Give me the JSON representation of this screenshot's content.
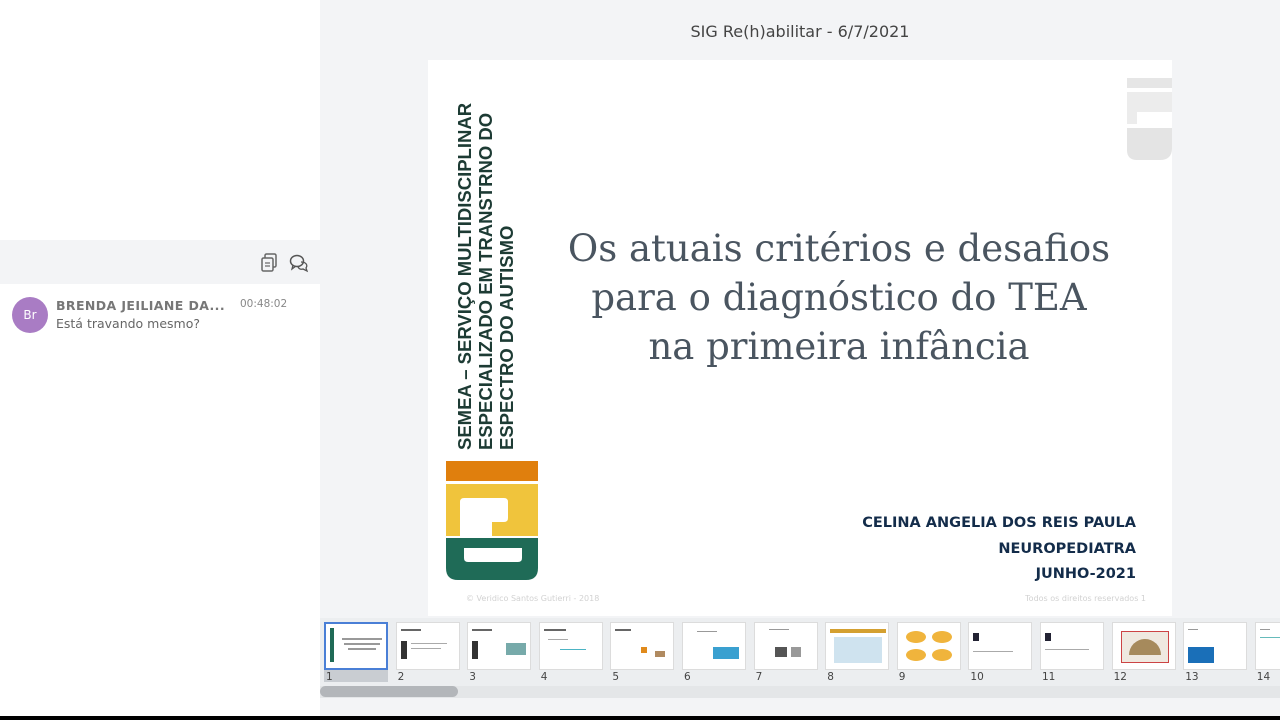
{
  "presentation": {
    "title": "SIG Re(h)abilitar - 6/7/2021"
  },
  "chat": {
    "messages": [
      {
        "avatar_initials": "Br",
        "author": "BRENDA JEILIANE DA...",
        "time": "00:48:02",
        "text": "Está travando mesmo?"
      }
    ],
    "toolbar_icons": [
      "copy-icon",
      "chat-bubbles-icon"
    ]
  },
  "slide": {
    "vertical_lines": [
      "SEMEA – SERVIÇO MULTIDISCIPLINAR",
      "ESPECIALIZADO EM TRANSTRNO DO",
      "ESPECTRO DO AUTISMO"
    ],
    "title_lines": [
      "Os atuais critérios e desafios",
      "para o diagnóstico do TEA",
      "na primeira infância"
    ],
    "author_lines": [
      "CELINA ANGELIA DOS REIS PAULA",
      "NEUROPEDIATRA",
      "JUNHO-2021"
    ],
    "footer_left": "© Veridico Santos Gutierri - 2018",
    "footer_right": "Todos os direitos reservados     1",
    "colors": {
      "orange": "#e07f0d",
      "yellow": "#f0c43c",
      "green": "#1f6b57"
    }
  },
  "thumbnails": [
    {
      "num": "1",
      "selected": true
    },
    {
      "num": "2"
    },
    {
      "num": "3"
    },
    {
      "num": "4"
    },
    {
      "num": "5"
    },
    {
      "num": "6"
    },
    {
      "num": "7"
    },
    {
      "num": "8"
    },
    {
      "num": "9"
    },
    {
      "num": "10"
    },
    {
      "num": "11"
    },
    {
      "num": "12"
    },
    {
      "num": "13"
    },
    {
      "num": "14"
    }
  ]
}
